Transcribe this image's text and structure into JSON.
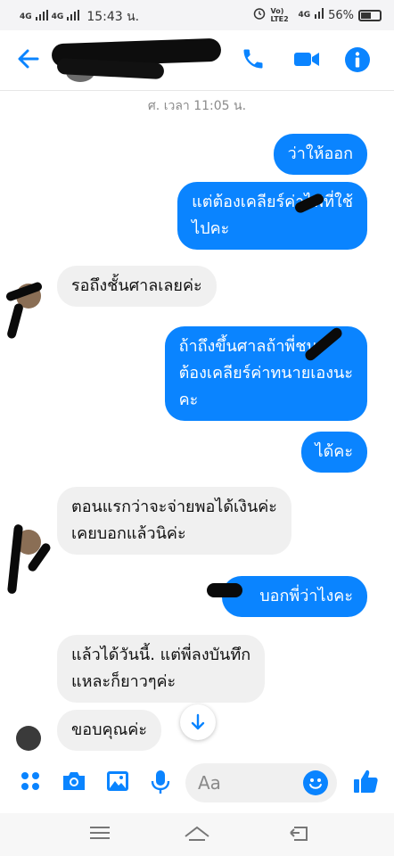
{
  "status_bar": {
    "network_left": "4G",
    "time": "15:43 น.",
    "volte": "Vo) LTE2",
    "network_right": "4G",
    "battery_percent": "56%",
    "battery_level": 0.56
  },
  "header": {
    "back_icon": "arrow-left-icon",
    "call_icon": "phone-icon",
    "video_icon": "video-camera-icon",
    "info_icon": "info-icon",
    "accent_color": "#0a84ff"
  },
  "thread": {
    "timestamp": "ศ. เวลา 11:05 น.",
    "messages": [
      {
        "direction": "out",
        "lines": [
          "ว่าให้ออก"
        ]
      },
      {
        "direction": "out",
        "lines": [
          "แต่ต้องเคลียร์ค่าไฟที่ใช้",
          "ไปคะ"
        ]
      },
      {
        "direction": "in",
        "lines": [
          "รอถึงชั้นศาลเลยค่ะ"
        ]
      },
      {
        "direction": "out",
        "lines": [
          "ถ้าถึงขึ้นศาลถ้าพี่ชนะ",
          "ต้องเคลียร์ค่าทนายเองนะ",
          "คะ"
        ]
      },
      {
        "direction": "out",
        "lines": [
          "ได้คะ"
        ]
      },
      {
        "direction": "in",
        "lines": [
          "ตอนแรกว่าจะจ่ายพอได้เงินค่ะ",
          "เคยบอกแล้วนิค่ะ"
        ]
      },
      {
        "direction": "out",
        "lines": [
          "บอกพี่ว่าไงคะ"
        ]
      },
      {
        "direction": "in",
        "lines": [
          "แล้วได้วันนี้. แต่พี่ลงบันทึก",
          "แหละก็ยาวๆค่ะ"
        ]
      },
      {
        "direction": "in",
        "lines": [
          "ขอบคุณค่ะ"
        ]
      }
    ]
  },
  "composer": {
    "placeholder": "Aa",
    "icons": [
      "apps-icon",
      "camera-icon",
      "image-icon",
      "microphone-icon",
      "emoji-icon",
      "thumbs-up-icon"
    ]
  },
  "scroll_down_icon": "arrow-down-icon",
  "nav_bar": {
    "icons": [
      "menu-icon",
      "home-icon",
      "back-icon"
    ]
  }
}
